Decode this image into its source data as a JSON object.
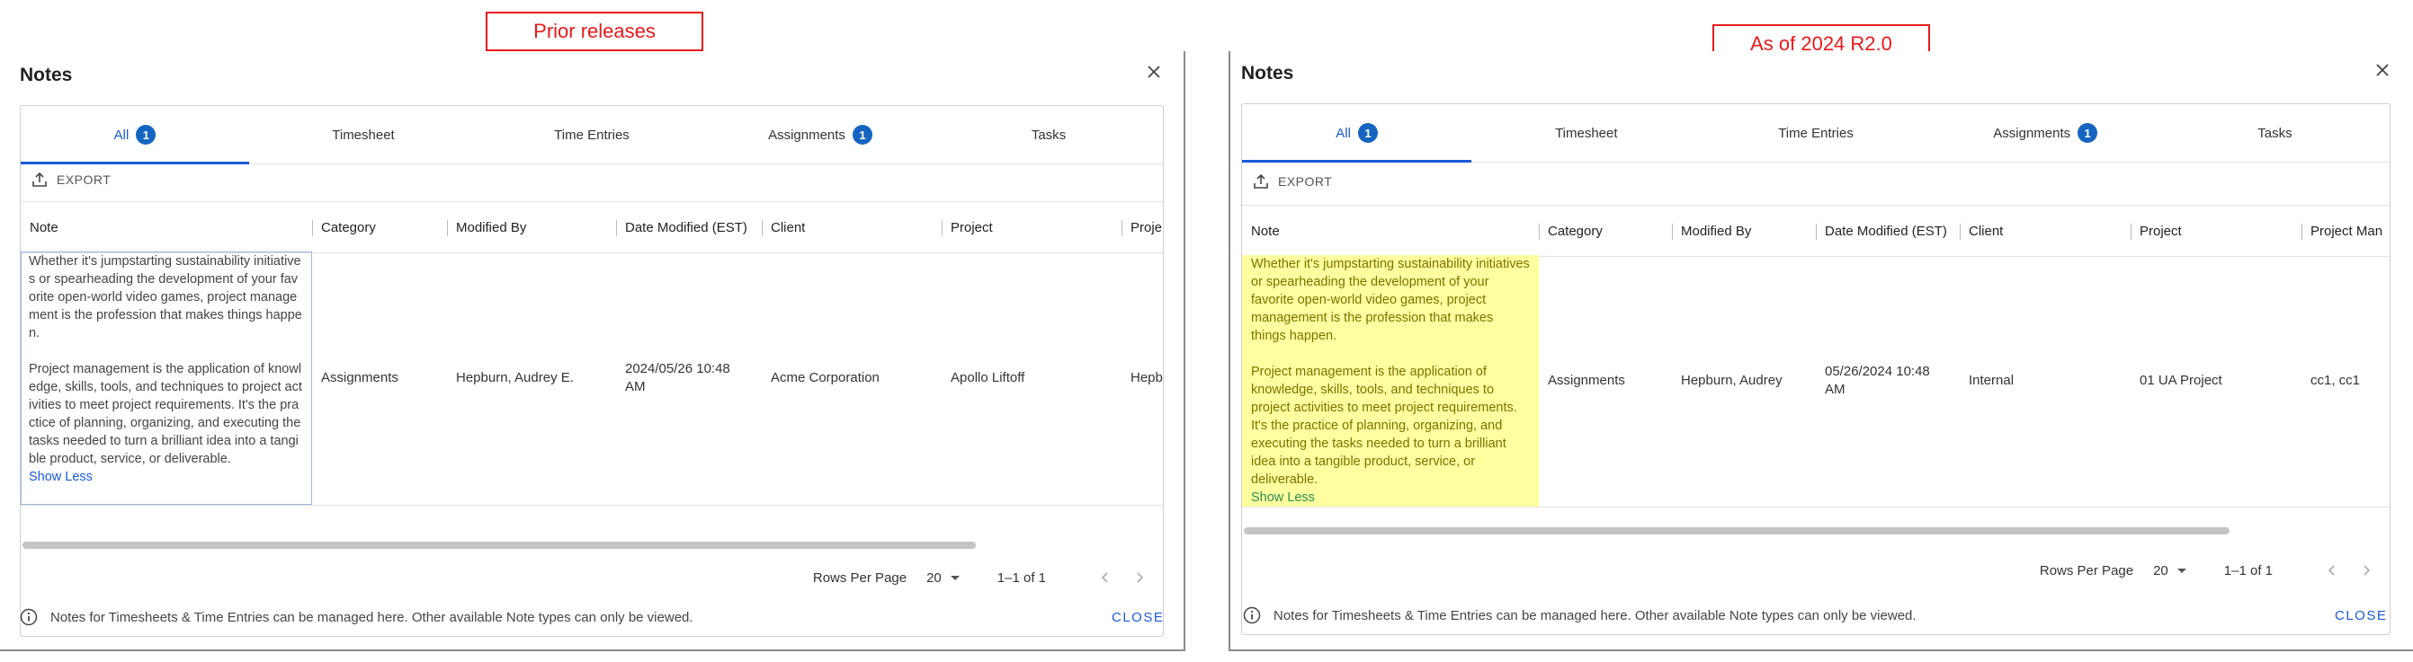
{
  "labels": {
    "prior": "Prior releases",
    "current": "As of 2024 R2.0"
  },
  "dialog_title": "Notes",
  "tabs": [
    {
      "label": "All",
      "badge": "1"
    },
    {
      "label": "Timesheet"
    },
    {
      "label": "Time Entries"
    },
    {
      "label": "Assignments",
      "badge": "1"
    },
    {
      "label": "Tasks"
    }
  ],
  "export_label": "EXPORT",
  "footer_text": "Notes for Timesheets & Time Entries can be managed here. Other available Note types can only be viewed.",
  "close_label": "CLOSE",
  "pager": {
    "rows_label": "Rows Per Page",
    "rows_value": "20",
    "range": "1–1 of 1"
  },
  "show_less": "Show Less",
  "left": {
    "columns": [
      "Note",
      "Category",
      "Modified By",
      "Date Modified (EST)",
      "Client",
      "Project",
      "Proje"
    ],
    "note_p1": "Whether it's jumpstarting sustainability initiatives or spearheading the development of your favorite open-world video games, project management is the profession that makes things happen.",
    "note_p2": "Project management is the application of knowledge, skills, tools, and techniques to project activities to meet project requirements.  It's the practice of planning, organizing, and executing the tasks needed to turn a brilliant idea into a tangible product, service, or deliverable.",
    "row": {
      "category": "Assignments",
      "modified_by": "Hepburn, Audrey E.",
      "date_line1": "2024/05/26 10:48",
      "date_line2": "AM",
      "client": "Acme Corporation",
      "project": "Apollo Liftoff",
      "extra": "Hepb"
    }
  },
  "right": {
    "columns": [
      "Note",
      "Category",
      "Modified By",
      "Date Modified (EST)",
      "Client",
      "Project",
      "Project Man"
    ],
    "note_p1": "Whether it's jumpstarting sustainability initiatives or spearheading the development of your favorite open-world video games, project management is the profession that makes things happen.",
    "note_p2": "Project management is the application of knowledge, skills, tools, and techniques to project activities to meet project requirements.  It's the practice of planning, organizing, and executing the tasks needed to turn a brilliant idea into a tangible product, service, or deliverable.",
    "row": {
      "category": "Assignments",
      "modified_by": "Hepburn, Audrey",
      "date_line1": "05/26/2024 10:48",
      "date_line2": "AM",
      "client": "Internal",
      "project": "01 UA Project",
      "extra": "cc1, cc1"
    }
  },
  "colors": {
    "accent": "#1a5ad7",
    "badge": "#1565c0",
    "label_red": "#e8191b",
    "highlight": "#ffff9f"
  },
  "icons": [
    "close-icon",
    "export-icon",
    "info-icon",
    "dropdown-arrow-icon",
    "chevron-left-icon",
    "chevron-right-icon"
  ]
}
